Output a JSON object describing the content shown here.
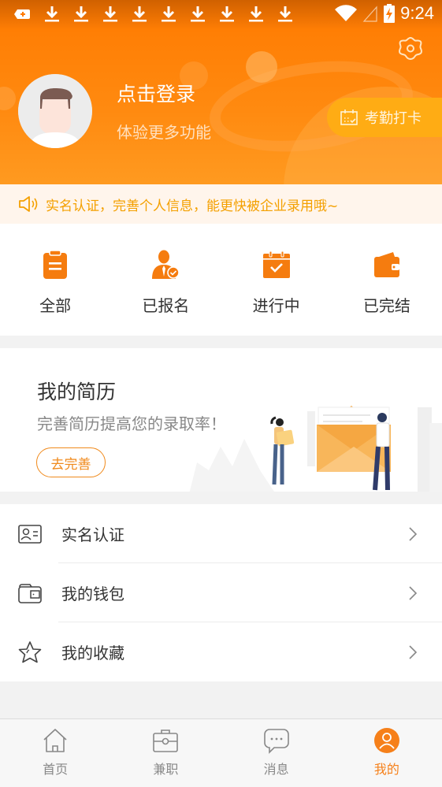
{
  "status_bar": {
    "time": "9:24",
    "notification_icons": [
      "add-notification-icon",
      "download-icon",
      "download-icon",
      "download-icon",
      "download-icon",
      "download-icon",
      "download-icon",
      "download-icon",
      "download-icon",
      "download-icon"
    ],
    "wifi": "wifi-icon",
    "signal": "signal-icon",
    "battery": "battery-charging-icon"
  },
  "header": {
    "login_title": "点击登录",
    "login_subtitle": "体验更多功能",
    "checkin_label": "考勤打卡",
    "settings_icon": "gear-icon"
  },
  "notice": {
    "text": "实名认证，完善个人信息，能更快被企业录用哦~",
    "icon": "speaker-icon"
  },
  "orders": [
    {
      "label": "全部",
      "icon": "clipboard-icon"
    },
    {
      "label": "已报名",
      "icon": "user-check-icon"
    },
    {
      "label": "进行中",
      "icon": "calendar-check-icon"
    },
    {
      "label": "已完结",
      "icon": "wallet-icon"
    }
  ],
  "resume": {
    "title": "我的简历",
    "subtitle": "完善简历提高您的录取率！",
    "button": "去完善"
  },
  "menu": [
    {
      "label": "实名认证",
      "icon": "id-card-icon"
    },
    {
      "label": "我的钱包",
      "icon": "wallet-outline-icon"
    },
    {
      "label": "我的收藏",
      "icon": "star-icon"
    }
  ],
  "tabbar": [
    {
      "label": "首页",
      "icon": "home-icon",
      "active": false
    },
    {
      "label": "兼职",
      "icon": "briefcase-icon",
      "active": false
    },
    {
      "label": "消息",
      "icon": "chat-bubble-icon",
      "active": false
    },
    {
      "label": "我的",
      "icon": "profile-icon",
      "active": true
    }
  ],
  "colors": {
    "brand_orange": "#ff7a00",
    "checkin_bg": "#ffac14",
    "notice_text": "#f4a000",
    "active_tab": "#f6801a"
  }
}
